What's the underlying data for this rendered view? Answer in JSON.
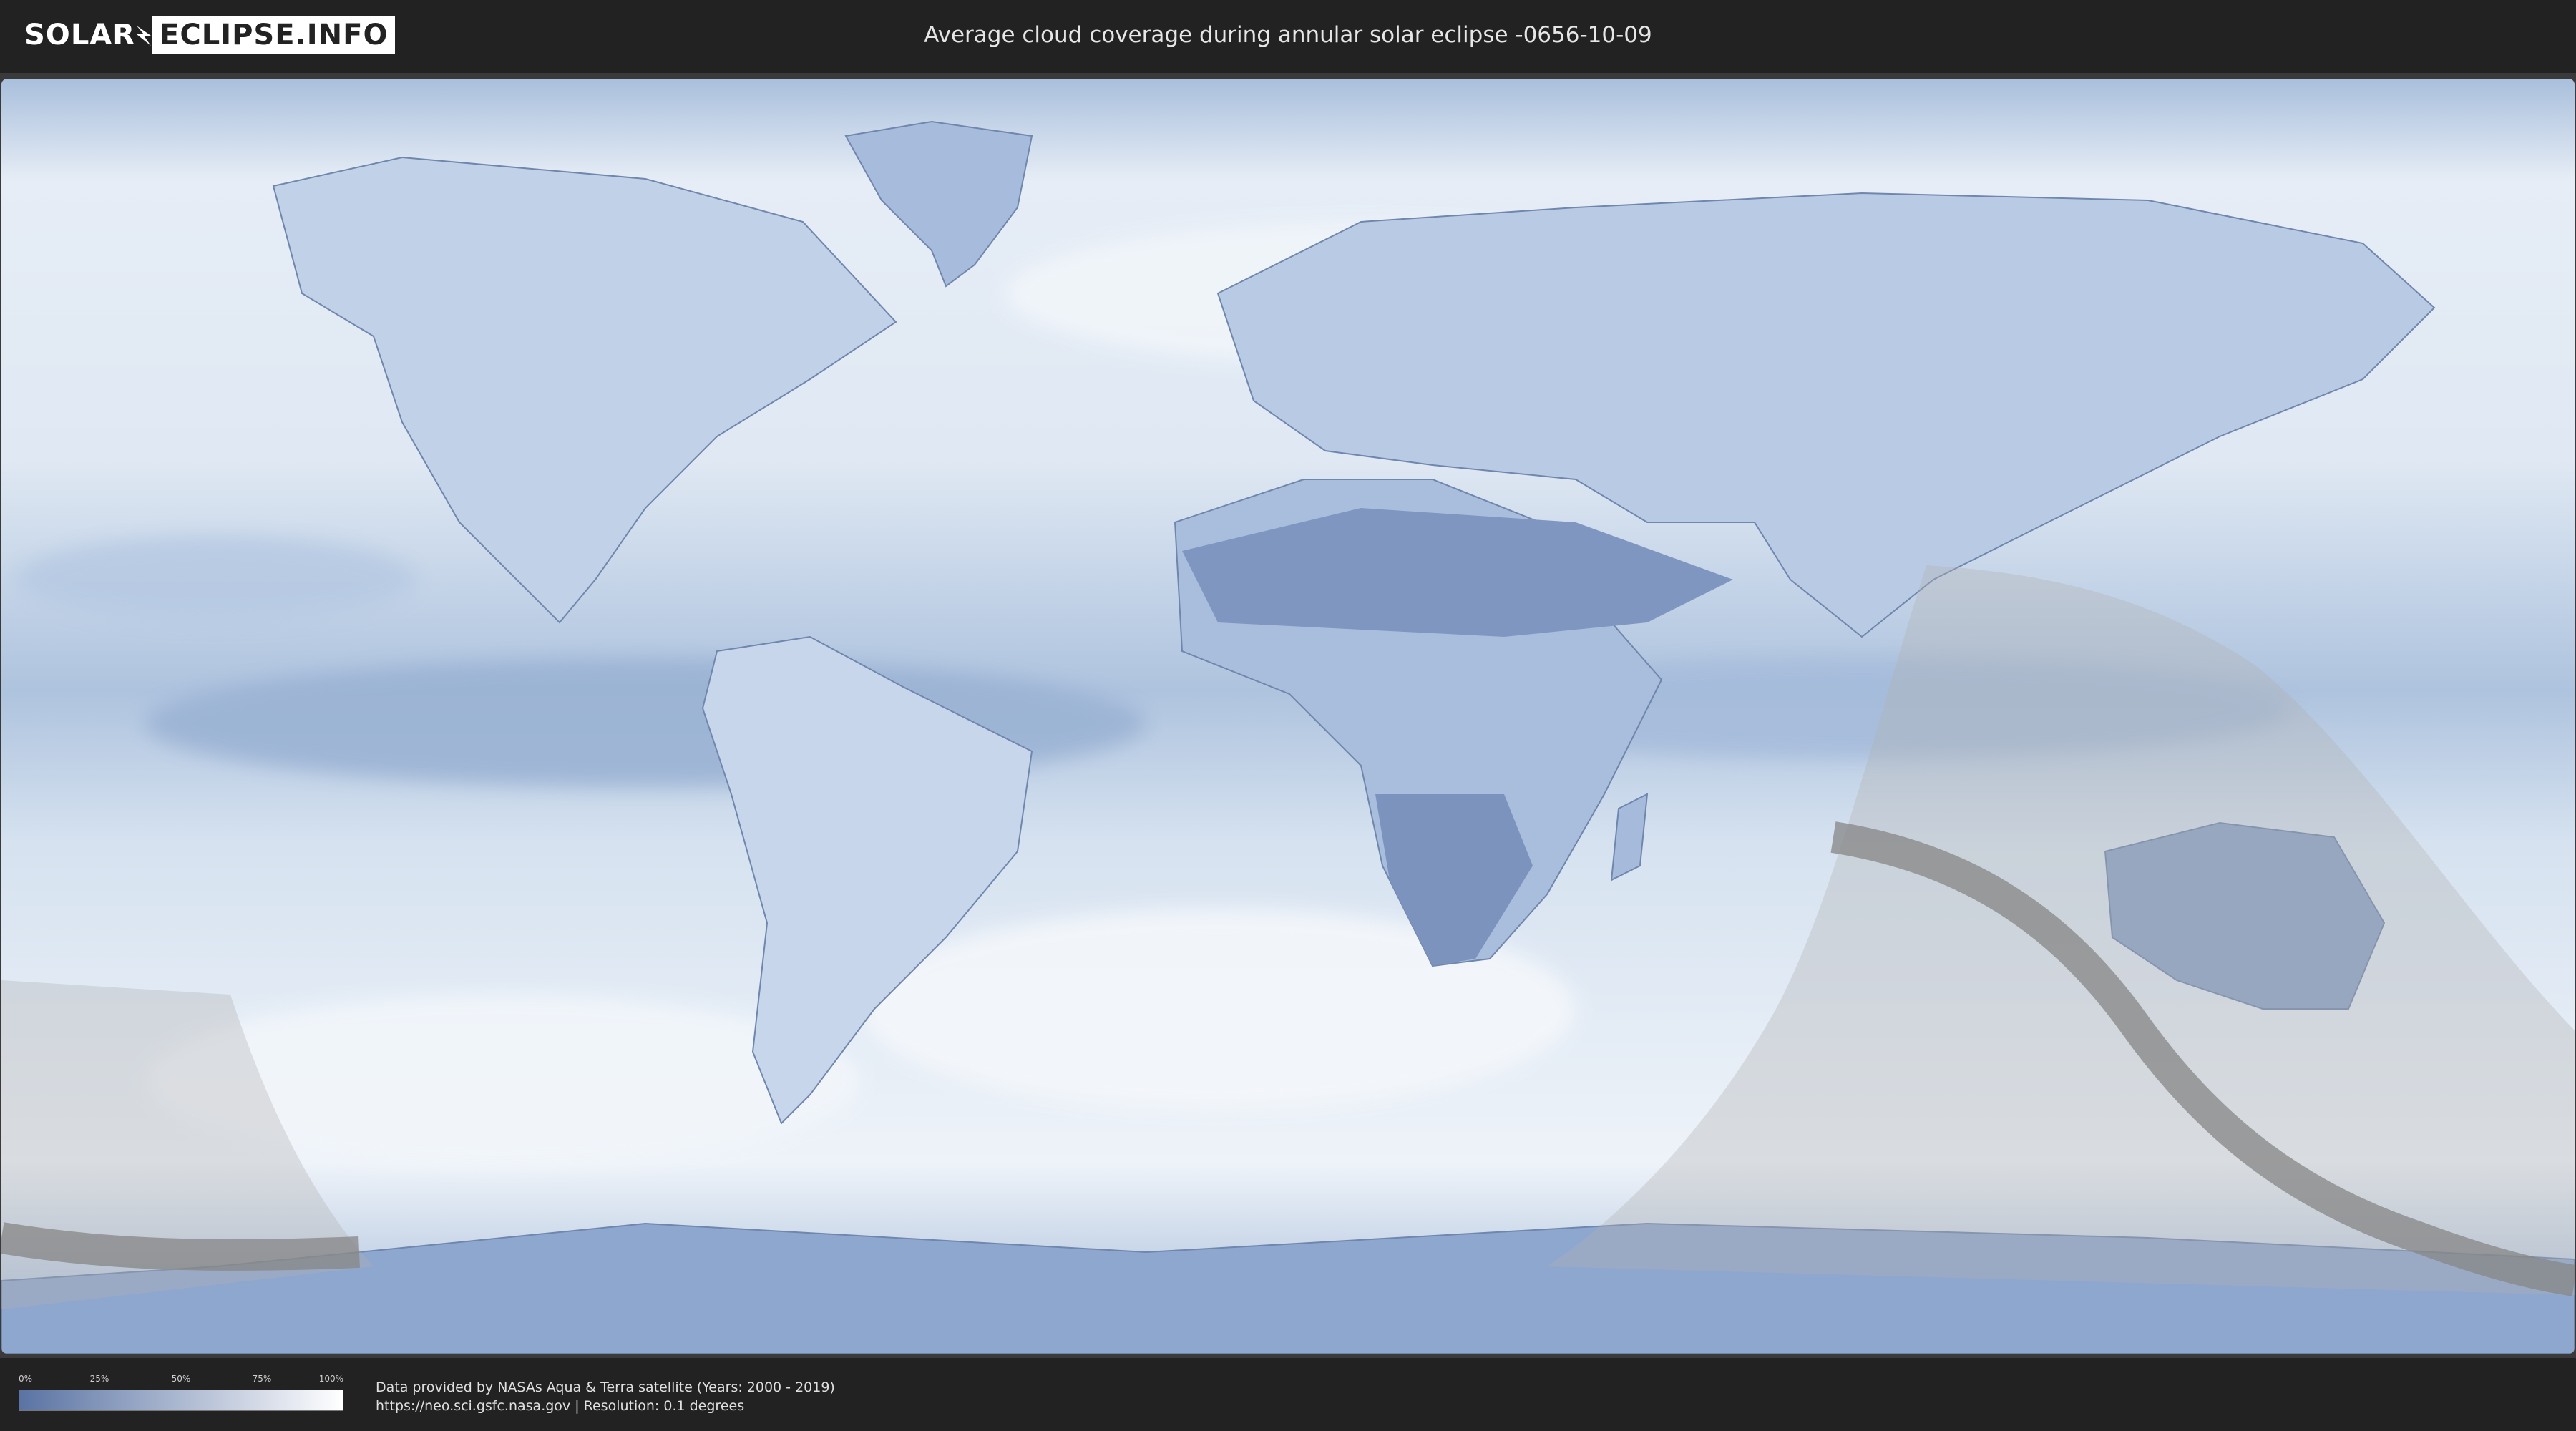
{
  "header": {
    "logo_left": "SOLAR",
    "logo_right": "ECLIPSE.INFO",
    "title": "Average cloud coverage during annular solar eclipse -0656-10-09"
  },
  "legend": {
    "ticks": [
      "0%",
      "25%",
      "50%",
      "75%",
      "100%"
    ],
    "gradient_from": "#5a73a3",
    "gradient_to": "#ffffff"
  },
  "footer": {
    "credit_line1": "Data provided by NASAs Aqua & Terra satellite (Years: 2000 - 2019)",
    "credit_line2": "https://neo.sci.gsfc.nasa.gov | Resolution: 0.1 degrees"
  },
  "colors": {
    "background": "#222222",
    "ocean_cloud": "#c9d7ea",
    "clear_land": "#5a73a3",
    "eclipse_shadow": "#9a9a9a"
  }
}
